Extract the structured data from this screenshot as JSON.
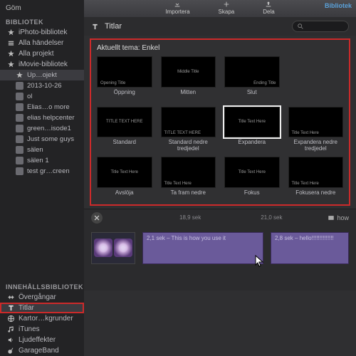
{
  "toolbar": {
    "import": "Importera",
    "create": "Skapa",
    "share": "Dela",
    "library": "Bibliotek"
  },
  "side": {
    "hide": "Göm",
    "bib": "BIBLIOTEK",
    "items": [
      "iPhoto-bibliotek",
      "Alla händelser",
      "Alla projekt",
      "iMovie-bibliotek",
      "Up…ojekt",
      "2013-10-26",
      "ol",
      "Elias…o more",
      "elias helpcenter",
      "green…isode1",
      "Just some guys",
      "sälen",
      "sälen 1",
      "test gr…creen"
    ],
    "content_head": "INNEHÅLLSBIBLIOTEK",
    "content": [
      "Övergångar",
      "Titlar",
      "Kartor…kgrunder",
      "iTunes",
      "Ljudeffekter",
      "GarageBand"
    ]
  },
  "header": {
    "title": "Titlar"
  },
  "panel": {
    "title": "Aktuellt tema: Enkel",
    "cells": [
      {
        "cap": "Öppning",
        "pos": "bl",
        "txt": "Opening Title"
      },
      {
        "cap": "Mitten",
        "pos": "c",
        "txt": "Middle Title"
      },
      {
        "cap": "Slut",
        "pos": "br",
        "txt": "Ending Title"
      },
      {
        "cap": "",
        "pos": "",
        "txt": ""
      },
      {
        "cap": "Standard",
        "pos": "c",
        "txt": "TITLE TEXT HERE"
      },
      {
        "cap": "Standard nedre tredjedel",
        "pos": "bl",
        "txt": "TITLE TEXT HERE"
      },
      {
        "cap": "Expandera",
        "pos": "c",
        "txt": "Title Text Here",
        "sel": true
      },
      {
        "cap": "Expandera nedre tredjedel",
        "pos": "bl",
        "txt": "Title Text Here"
      },
      {
        "cap": "Avslöja",
        "pos": "c",
        "txt": "Title Text Here"
      },
      {
        "cap": "Ta fram nedre",
        "pos": "bl",
        "txt": "Title Text Here"
      },
      {
        "cap": "Fokus",
        "pos": "c",
        "txt": "Title Text Here"
      },
      {
        "cap": "Fokusera nedre",
        "pos": "bl",
        "txt": "Title Text Here"
      }
    ]
  },
  "timeline": {
    "marks": [
      "18,9 sek",
      "21,0 sek"
    ],
    "how": "how",
    "clips": [
      "2,1 sek – This is how you use it",
      "2,8 sek – hello!!!!!!!!!!!!!!"
    ]
  }
}
